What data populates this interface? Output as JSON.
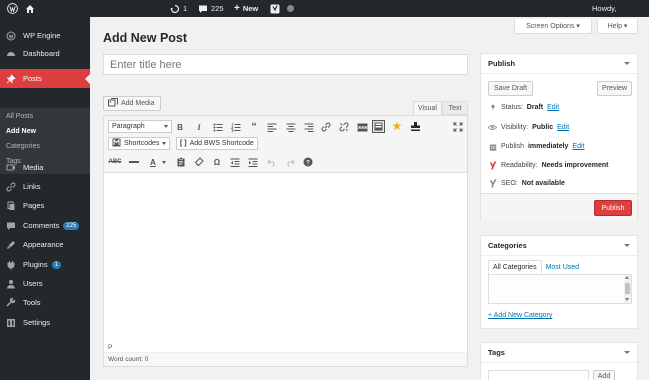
{
  "adminbar": {
    "updates_count": "1",
    "comments_count": "225",
    "new_label": "New",
    "howdy": "Howdy,"
  },
  "sidebar": {
    "items": [
      {
        "label": "WP Engine",
        "icon": "wp-engine-icon"
      },
      {
        "label": "Dashboard",
        "icon": "dashboard-icon"
      },
      {
        "label": "Posts",
        "icon": "pin-icon"
      },
      {
        "label": "Media",
        "icon": "media-icon"
      },
      {
        "label": "Links",
        "icon": "links-icon"
      },
      {
        "label": "Pages",
        "icon": "pages-icon"
      },
      {
        "label": "Comments",
        "icon": "comments-icon",
        "count": "225"
      },
      {
        "label": "Appearance",
        "icon": "appearance-icon"
      },
      {
        "label": "Plugins",
        "icon": "plugins-icon",
        "count": "1"
      },
      {
        "label": "Users",
        "icon": "users-icon"
      },
      {
        "label": "Tools",
        "icon": "tools-icon"
      },
      {
        "label": "Settings",
        "icon": "settings-icon"
      }
    ],
    "posts_submenu": [
      "All Posts",
      "Add New",
      "Categories",
      "Tags"
    ]
  },
  "screen_options_label": "Screen Options ▾",
  "help_label": "Help ▾",
  "page_title": "Add New Post",
  "title_placeholder": "Enter title here",
  "add_media_label": "Add Media",
  "editor": {
    "tab_visual": "Visual",
    "tab_text": "Text",
    "format_select": "Paragraph",
    "shortcodes_label": "Shortcodes",
    "bws_label": "Add BWS Shortcode",
    "path": "P",
    "word_count": "Word count: 0"
  },
  "publish": {
    "title": "Publish",
    "save_draft": "Save Draft",
    "preview": "Preview",
    "status_label": "Status:",
    "status_value": "Draft",
    "visibility_label": "Visibility:",
    "visibility_value": "Public",
    "publish_label": "Publish",
    "publish_value": "immediately",
    "edit": "Edit",
    "readability_label": "Readability:",
    "readability_value": "Needs improvement",
    "seo_label": "SEO:",
    "seo_value": "Not available",
    "publish_button": "Publish"
  },
  "categories": {
    "title": "Categories",
    "tab_all": "All Categories",
    "tab_used": "Most Used",
    "add_new": "+ Add New Category"
  },
  "tags": {
    "title": "Tags",
    "add_button": "Add"
  },
  "colors": {
    "accent": "#dd3e3f",
    "adminbar": "#23282d",
    "link": "#0073aa"
  }
}
